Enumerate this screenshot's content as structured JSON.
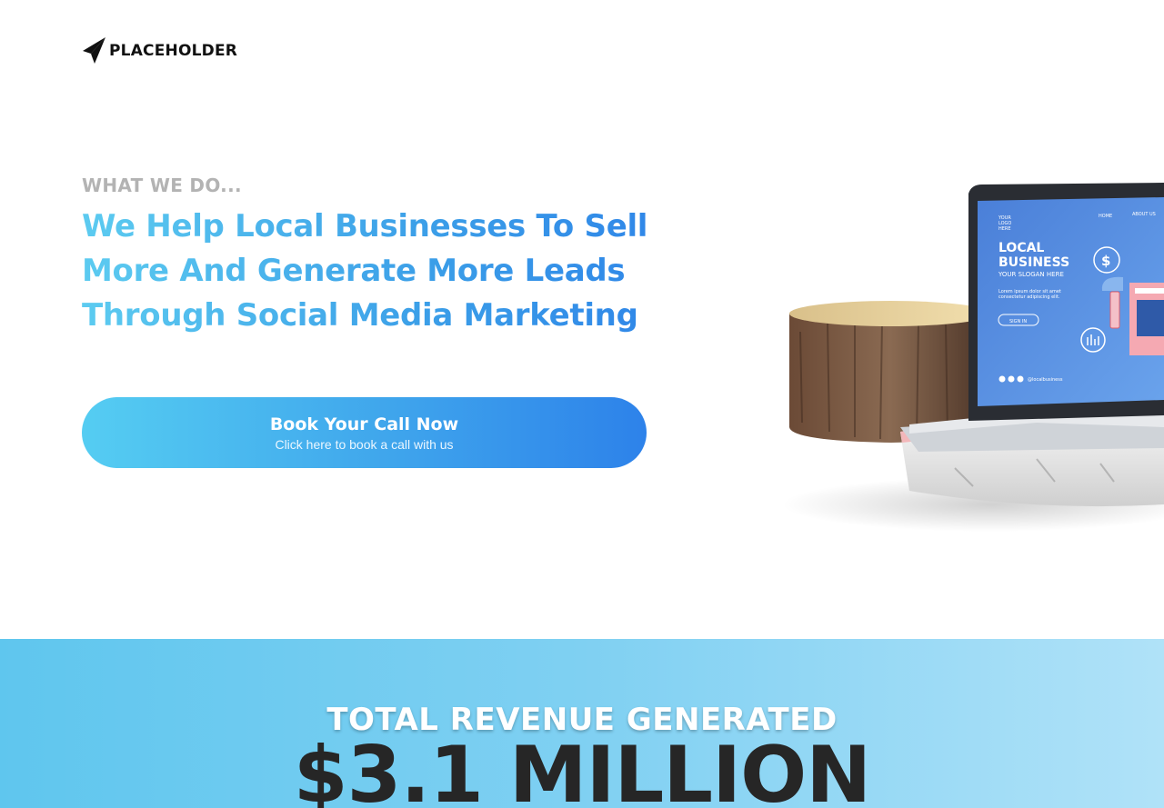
{
  "brand": {
    "name": "PLACEHOLDER",
    "icon": "paper-plane-icon"
  },
  "hero": {
    "eyebrow": "WHAT WE DO...",
    "headline": "We Help Local Businesses To Sell More And Generate More Leads Through Social Media Marketing",
    "cta": {
      "title": "Book Your Call Now",
      "subtitle": "Click here to book a call with us"
    }
  },
  "mockup": {
    "nav": [
      "HOME",
      "ABOUT US"
    ],
    "logo_text": [
      "YOUR",
      "LOGO",
      "HERE"
    ],
    "title_line1": "LOCAL",
    "title_line2": "BUSINESS",
    "slogan": "YOUR SLOGAN HERE",
    "body_line1": "Lorem ipsum dolor sit amet",
    "body_line2": "consectetur adipiscing elit.",
    "button": "SIGN IN",
    "handle": "@localbusiness"
  },
  "stats": {
    "label": "TOTAL REVENUE GENERATED",
    "value": "$3.1 MILLION"
  },
  "colors": {
    "gradient_start": "#55cdf2",
    "gradient_end": "#2d82ea",
    "eyebrow": "#b3b3b3",
    "value": "#262626"
  }
}
